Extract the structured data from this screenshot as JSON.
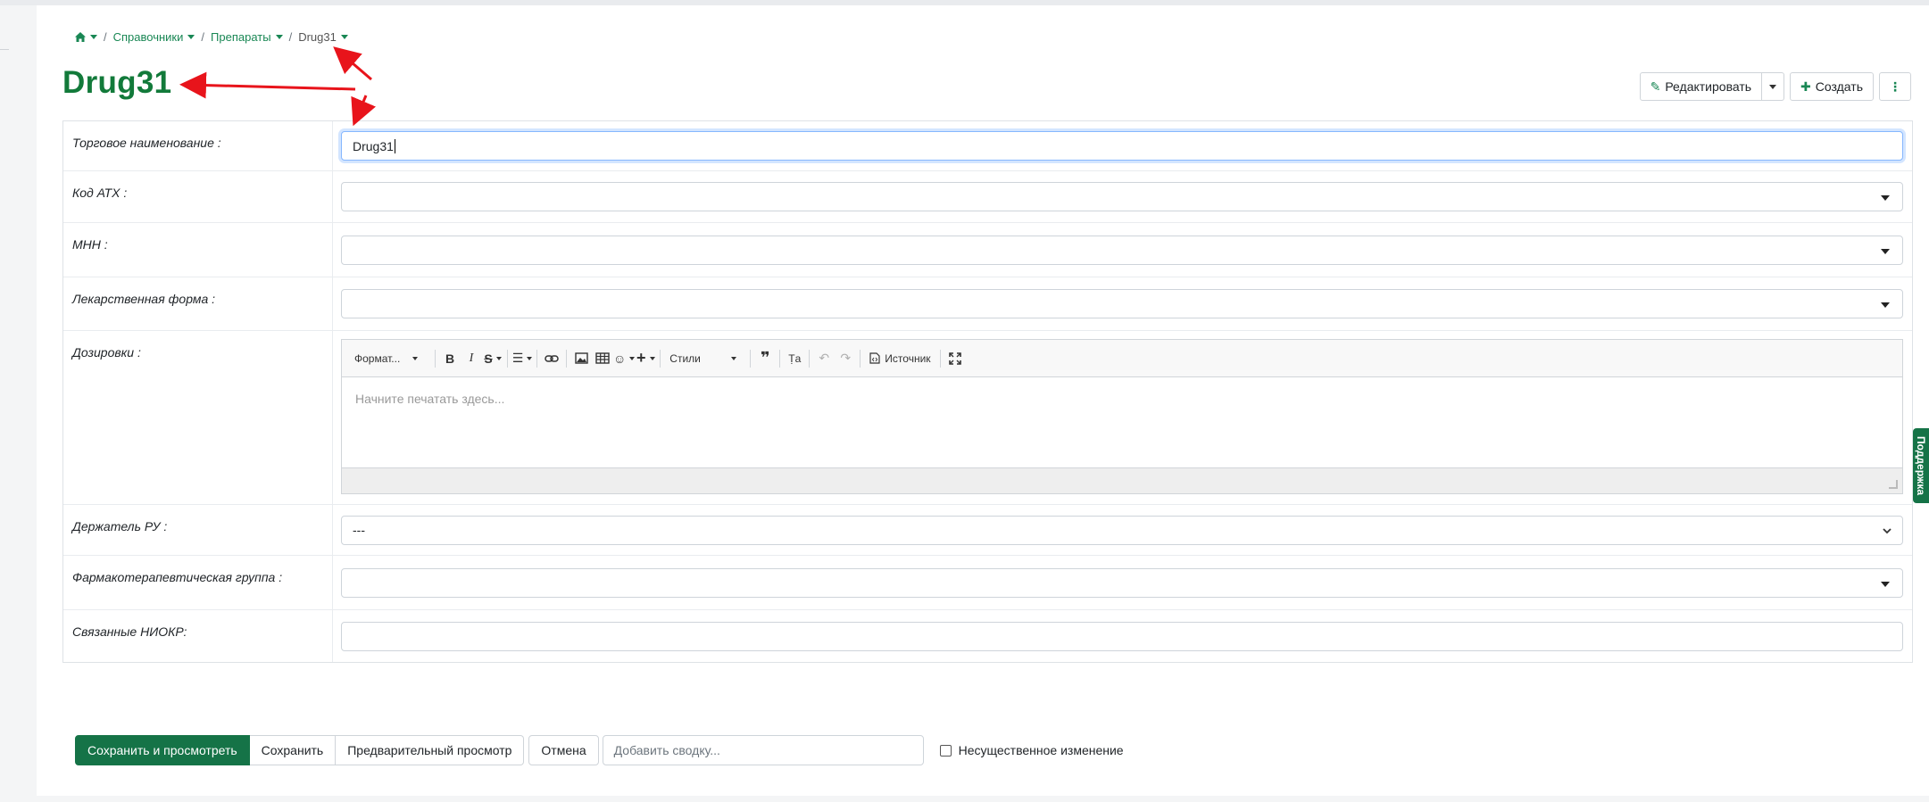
{
  "breadcrumb": {
    "home_icon": "home-icon",
    "items": [
      {
        "label": "Справочники"
      },
      {
        "label": "Препараты"
      },
      {
        "label": "Drug31"
      }
    ],
    "separator": "/"
  },
  "page": {
    "title": "Drug31"
  },
  "actions": {
    "edit_label": "Редактировать",
    "create_label": "Создать",
    "more_icon": "vertical-dots-icon"
  },
  "form": {
    "trade_name": {
      "label": "Торговое наименование :",
      "value": "Drug31"
    },
    "atc": {
      "label": "Код АТХ :",
      "value": ""
    },
    "inn": {
      "label": "МНН :",
      "value": ""
    },
    "dosage_form": {
      "label": "Лекарственная форма :",
      "value": ""
    },
    "dosages": {
      "label": "Дозировки :",
      "placeholder": "Начните печатать здесь...",
      "toolbar": {
        "format_label": "Формат...",
        "styles_label": "Стили",
        "source_label": "Источник"
      }
    },
    "holder": {
      "label": "Держатель РУ :",
      "value": "---"
    },
    "pharma_group": {
      "label": "Фармакотерапевтическая группа :",
      "value": ""
    },
    "related": {
      "label": "Связанные НИОКР:",
      "value": ""
    }
  },
  "bottom": {
    "save_view_label": "Сохранить и просмотреть",
    "save_label": "Сохранить",
    "preview_label": "Предварительный просмотр",
    "cancel_label": "Отмена",
    "summary_placeholder": "Добавить сводку...",
    "minor_change_label": "Несущественное изменение",
    "minor_change_checked": false
  },
  "support_tab": {
    "label": "Поддержка"
  },
  "colors": {
    "primary_green": "#157347",
    "title_green": "#127a3a",
    "link_green": "#198754",
    "annotation_red": "#e8141b"
  }
}
